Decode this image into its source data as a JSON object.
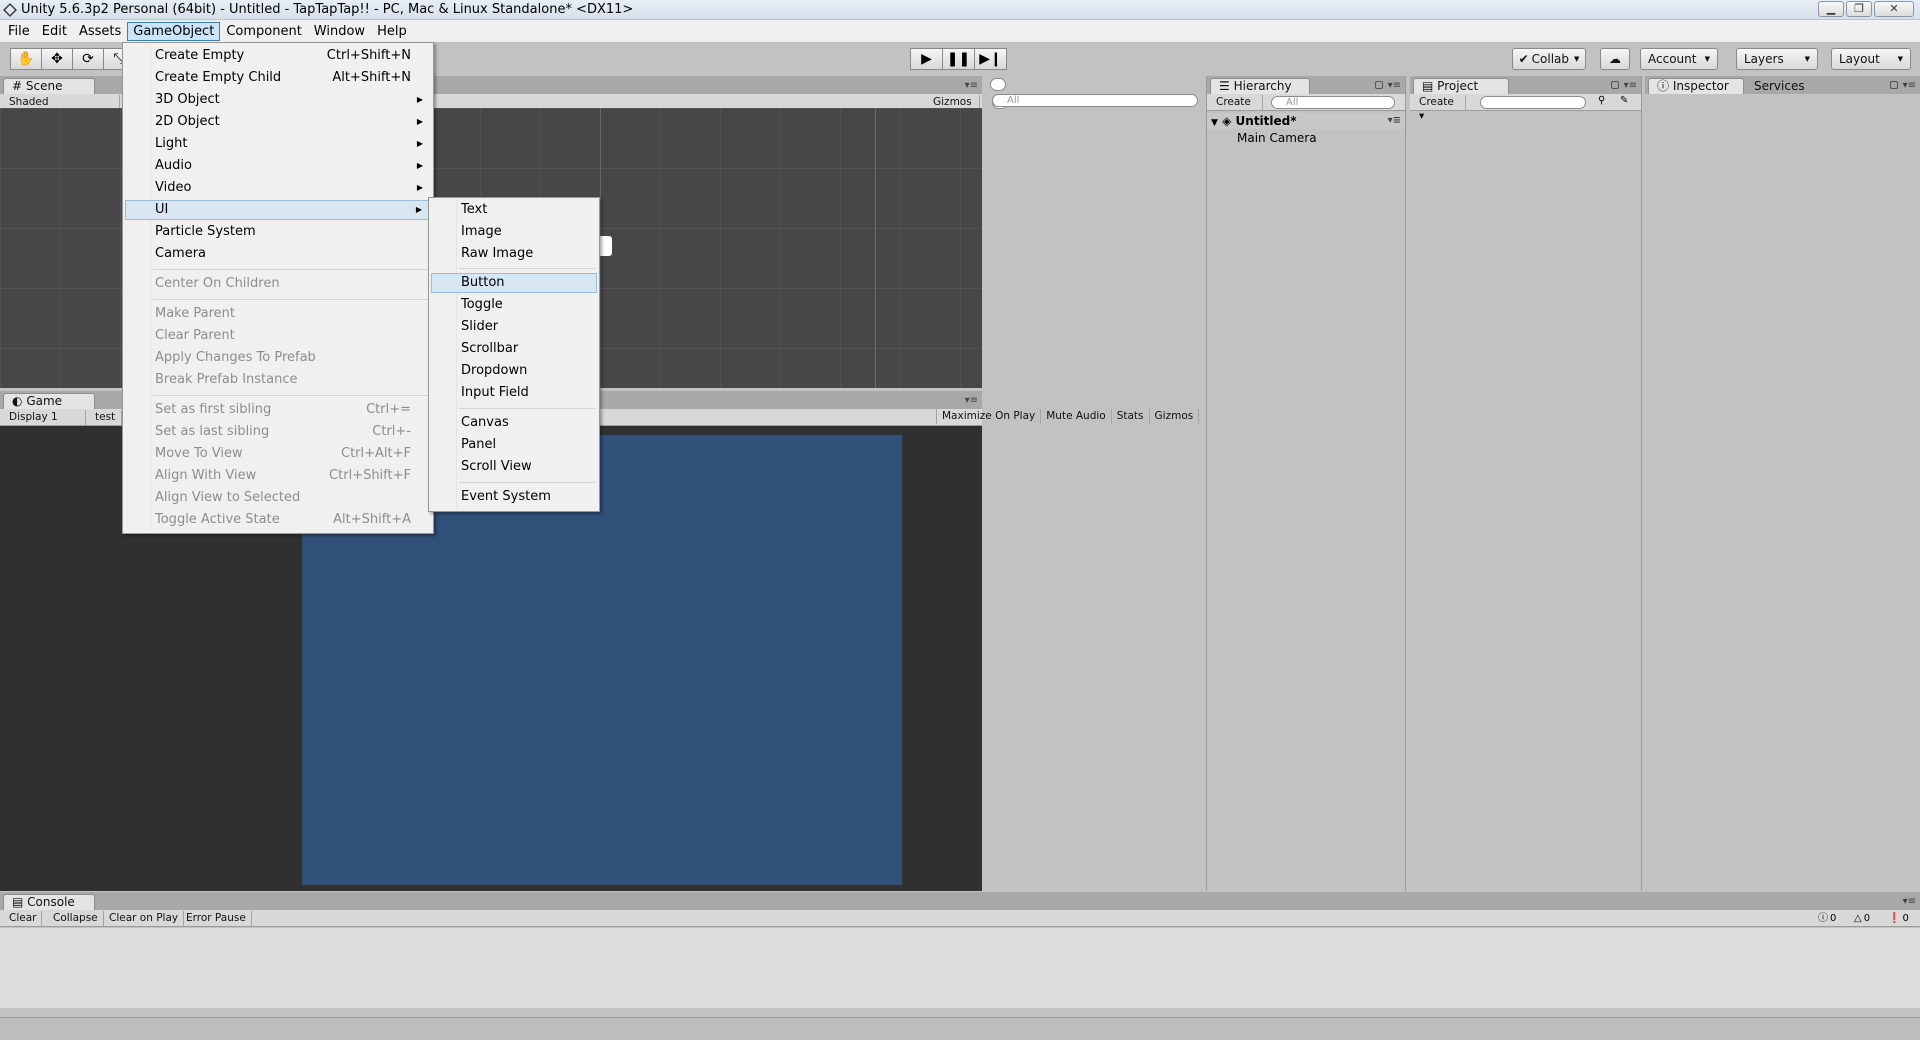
{
  "window": {
    "title": "Unity 5.6.3p2 Personal (64bit) - Untitled - TapTapTap!! - PC, Mac & Linux Standalone* <DX11>"
  },
  "menubar": [
    "File",
    "Edit",
    "Assets",
    "GameObject",
    "Component",
    "Window",
    "Help"
  ],
  "toolbar": {
    "collab": "Collab",
    "account": "Account",
    "layers": "Layers",
    "layout": "Layout"
  },
  "scene": {
    "tab": "Scene",
    "shading": "Shaded",
    "gizmos": "Gizmos",
    "search_placeholder": "All"
  },
  "game": {
    "tab": "Game",
    "display": "Display 1",
    "aspect": "test (",
    "maximize": "Maximize On Play",
    "mute": "Mute Audio",
    "stats": "Stats",
    "gizmos": "Gizmos"
  },
  "hierarchy": {
    "tab": "Hierarchy",
    "create": "Create",
    "search_placeholder": "All",
    "scene_name": "Untitled*",
    "items": [
      "Main Camera"
    ]
  },
  "project": {
    "tab": "Project",
    "create": "Create"
  },
  "inspector": {
    "tab": "Inspector",
    "services_tab": "Services"
  },
  "console": {
    "tab": "Console",
    "buttons": [
      "Clear",
      "Collapse",
      "Clear on Play",
      "Error Pause"
    ],
    "info_count": "0",
    "warn_count": "0",
    "error_count": "0"
  },
  "gameobject_menu": {
    "items": [
      {
        "label": "Create Empty",
        "shortcut": "Ctrl+Shift+N"
      },
      {
        "label": "Create Empty Child",
        "shortcut": "Alt+Shift+N"
      },
      {
        "label": "3D Object"
      },
      {
        "label": "2D Object"
      },
      {
        "label": "Light"
      },
      {
        "label": "Audio"
      },
      {
        "label": "Video"
      },
      {
        "label": "UI"
      },
      {
        "label": "Particle System"
      },
      {
        "label": "Camera"
      },
      {
        "label": "Center On Children"
      },
      {
        "label": "Make Parent"
      },
      {
        "label": "Clear Parent"
      },
      {
        "label": "Apply Changes To Prefab"
      },
      {
        "label": "Break Prefab Instance"
      },
      {
        "label": "Set as first sibling",
        "shortcut": "Ctrl+="
      },
      {
        "label": "Set as last sibling",
        "shortcut": "Ctrl+-"
      },
      {
        "label": "Move To View",
        "shortcut": "Ctrl+Alt+F"
      },
      {
        "label": "Align With View",
        "shortcut": "Ctrl+Shift+F"
      },
      {
        "label": "Align View to Selected"
      },
      {
        "label": "Toggle Active State",
        "shortcut": "Alt+Shift+A"
      }
    ]
  },
  "ui_submenu": {
    "items": [
      "Text",
      "Image",
      "Raw Image",
      "Button",
      "Toggle",
      "Slider",
      "Scrollbar",
      "Dropdown",
      "Input Field",
      "Canvas",
      "Panel",
      "Scroll View",
      "Event System"
    ]
  },
  "colors": {
    "game_canvas": "#30507a",
    "menu_highlight": "#d8e6f2"
  }
}
